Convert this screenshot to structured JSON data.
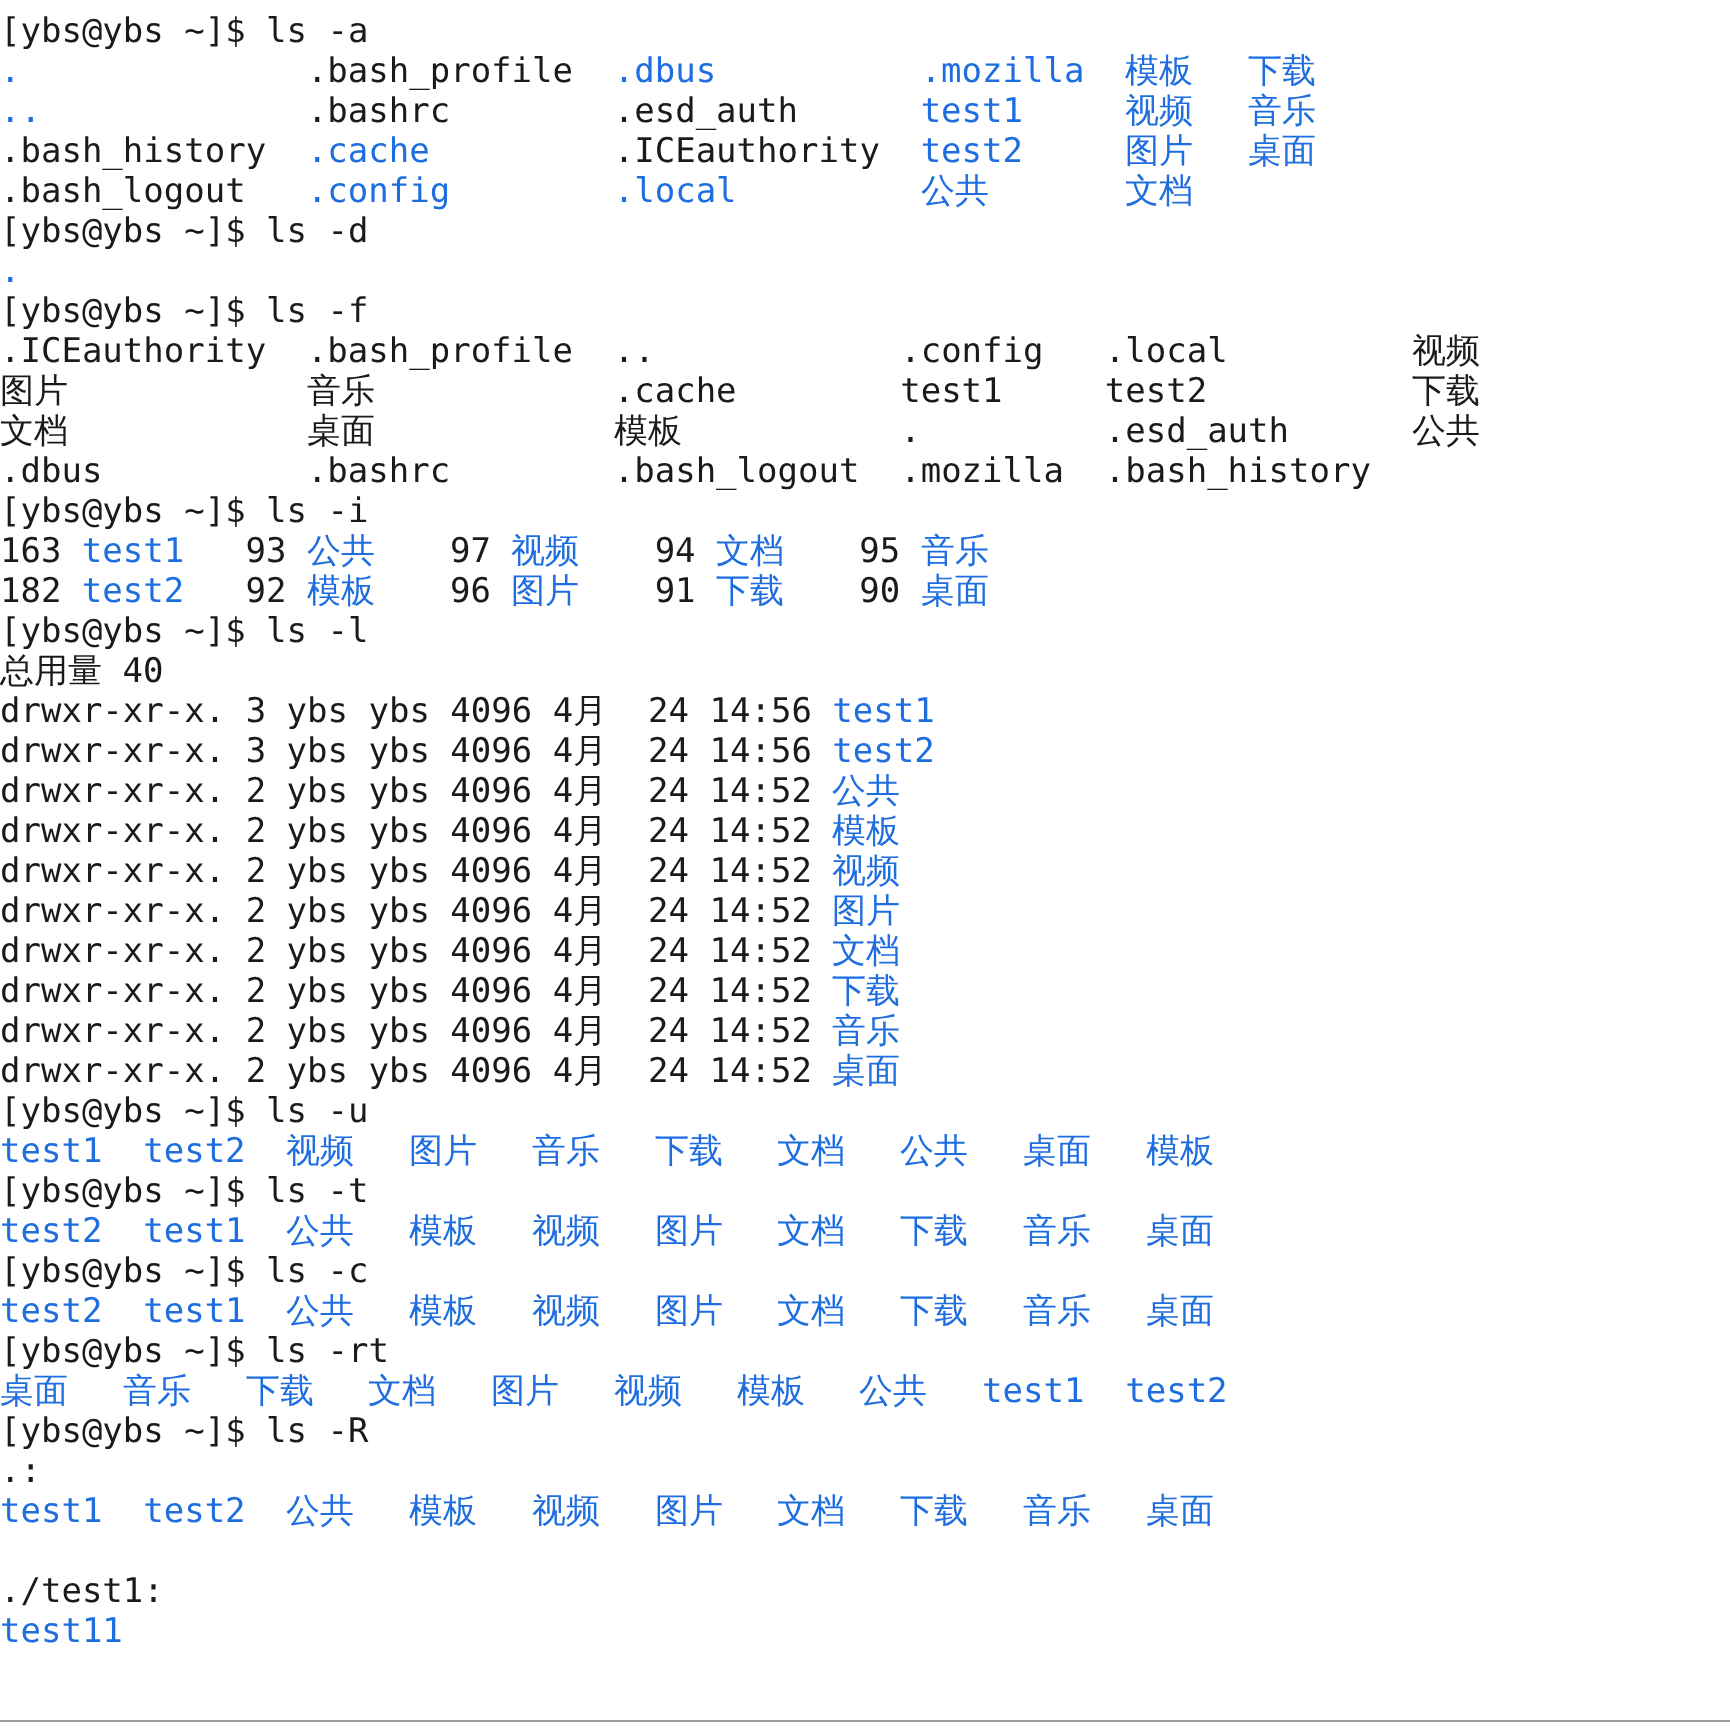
{
  "lines": [
    {
      "kind": "prompt",
      "text": "[ybs@ybs ~]$ ls -a"
    },
    {
      "kind": "grid",
      "rows": [
        [
          {
            "name": ".",
            "kind": "dir"
          },
          {
            "name": ".bash_profile",
            "kind": "file"
          },
          {
            "name": ".dbus",
            "kind": "dir"
          },
          {
            "name": ".mozilla",
            "kind": "dir"
          },
          {
            "name": "模板",
            "kind": "dir"
          },
          {
            "name": "下载",
            "kind": "dir"
          }
        ],
        [
          {
            "name": "..",
            "kind": "dir"
          },
          {
            "name": ".bashrc",
            "kind": "file"
          },
          {
            "name": ".esd_auth",
            "kind": "file"
          },
          {
            "name": "test1",
            "kind": "dir"
          },
          {
            "name": "视频",
            "kind": "dir"
          },
          {
            "name": "音乐",
            "kind": "dir"
          }
        ],
        [
          {
            "name": ".bash_history",
            "kind": "file"
          },
          {
            "name": ".cache",
            "kind": "dir"
          },
          {
            "name": ".ICEauthority",
            "kind": "file"
          },
          {
            "name": "test2",
            "kind": "dir"
          },
          {
            "name": "图片",
            "kind": "dir"
          },
          {
            "name": "桌面",
            "kind": "dir"
          }
        ],
        [
          {
            "name": ".bash_logout",
            "kind": "file"
          },
          {
            "name": ".config",
            "kind": "dir"
          },
          {
            "name": ".local",
            "kind": "dir"
          },
          {
            "name": "公共",
            "kind": "dir"
          },
          {
            "name": "文档",
            "kind": "dir"
          }
        ]
      ]
    },
    {
      "kind": "prompt",
      "text": "[ybs@ybs ~]$ ls -d"
    },
    {
      "kind": "grid",
      "rows": [
        [
          {
            "name": ".",
            "kind": "dir"
          }
        ]
      ]
    },
    {
      "kind": "prompt",
      "text": "[ybs@ybs ~]$ ls -f"
    },
    {
      "kind": "grid",
      "rows": [
        [
          {
            "name": ".ICEauthority",
            "kind": "file"
          },
          {
            "name": ".bash_profile",
            "kind": "file"
          },
          {
            "name": "..",
            "kind": "file"
          },
          {
            "name": ".config",
            "kind": "file"
          },
          {
            "name": ".local",
            "kind": "file"
          },
          {
            "name": "视频",
            "kind": "file"
          }
        ],
        [
          {
            "name": "图片",
            "kind": "file"
          },
          {
            "name": "音乐",
            "kind": "file"
          },
          {
            "name": ".cache",
            "kind": "file"
          },
          {
            "name": "test1",
            "kind": "file"
          },
          {
            "name": "test2",
            "kind": "file"
          },
          {
            "name": "下载",
            "kind": "file"
          }
        ],
        [
          {
            "name": "文档",
            "kind": "file"
          },
          {
            "name": "桌面",
            "kind": "file"
          },
          {
            "name": "模板",
            "kind": "file"
          },
          {
            "name": ".",
            "kind": "file"
          },
          {
            "name": ".esd_auth",
            "kind": "file"
          },
          {
            "name": "公共",
            "kind": "file"
          }
        ],
        [
          {
            "name": ".dbus",
            "kind": "file"
          },
          {
            "name": ".bashrc",
            "kind": "file"
          },
          {
            "name": ".bash_logout",
            "kind": "file"
          },
          {
            "name": ".mozilla",
            "kind": "file"
          },
          {
            "name": ".bash_history",
            "kind": "file"
          }
        ]
      ]
    },
    {
      "kind": "prompt",
      "text": "[ybs@ybs ~]$ ls -i"
    },
    {
      "kind": "grid",
      "rows": [
        [
          {
            "inode": "163",
            "name": "test1",
            "kind": "dir"
          },
          {
            "inode": "93",
            "name": "公共",
            "kind": "dir"
          },
          {
            "inode": "97",
            "name": "视频",
            "kind": "dir"
          },
          {
            "inode": "94",
            "name": "文档",
            "kind": "dir"
          },
          {
            "inode": "95",
            "name": "音乐",
            "kind": "dir"
          }
        ],
        [
          {
            "inode": "182",
            "name": "test2",
            "kind": "dir"
          },
          {
            "inode": "92",
            "name": "模板",
            "kind": "dir"
          },
          {
            "inode": "96",
            "name": "图片",
            "kind": "dir"
          },
          {
            "inode": "91",
            "name": "下载",
            "kind": "dir"
          },
          {
            "inode": "90",
            "name": "桌面",
            "kind": "dir"
          }
        ]
      ]
    },
    {
      "kind": "prompt",
      "text": "[ybs@ybs ~]$ ls -l"
    },
    {
      "kind": "text",
      "text": "总用量 40"
    },
    {
      "kind": "long",
      "info": "drwxr-xr-x. 3 ybs ybs 4096 4月  24 14:56",
      "file": {
        "name": "test1",
        "kind": "dir"
      }
    },
    {
      "kind": "long",
      "info": "drwxr-xr-x. 3 ybs ybs 4096 4月  24 14:56",
      "file": {
        "name": "test2",
        "kind": "dir"
      }
    },
    {
      "kind": "long",
      "info": "drwxr-xr-x. 2 ybs ybs 4096 4月  24 14:52",
      "file": {
        "name": "公共",
        "kind": "dir"
      }
    },
    {
      "kind": "long",
      "info": "drwxr-xr-x. 2 ybs ybs 4096 4月  24 14:52",
      "file": {
        "name": "模板",
        "kind": "dir"
      }
    },
    {
      "kind": "long",
      "info": "drwxr-xr-x. 2 ybs ybs 4096 4月  24 14:52",
      "file": {
        "name": "视频",
        "kind": "dir"
      }
    },
    {
      "kind": "long",
      "info": "drwxr-xr-x. 2 ybs ybs 4096 4月  24 14:52",
      "file": {
        "name": "图片",
        "kind": "dir"
      }
    },
    {
      "kind": "long",
      "info": "drwxr-xr-x. 2 ybs ybs 4096 4月  24 14:52",
      "file": {
        "name": "文档",
        "kind": "dir"
      }
    },
    {
      "kind": "long",
      "info": "drwxr-xr-x. 2 ybs ybs 4096 4月  24 14:52",
      "file": {
        "name": "下载",
        "kind": "dir"
      }
    },
    {
      "kind": "long",
      "info": "drwxr-xr-x. 2 ybs ybs 4096 4月  24 14:52",
      "file": {
        "name": "音乐",
        "kind": "dir"
      }
    },
    {
      "kind": "long",
      "info": "drwxr-xr-x. 2 ybs ybs 4096 4月  24 14:52",
      "file": {
        "name": "桌面",
        "kind": "dir"
      }
    },
    {
      "kind": "prompt",
      "text": "[ybs@ybs ~]$ ls -u"
    },
    {
      "kind": "grid",
      "rows": [
        [
          {
            "name": "test1",
            "kind": "dir"
          },
          {
            "name": "test2",
            "kind": "dir"
          },
          {
            "name": "视频",
            "kind": "dir"
          },
          {
            "name": "图片",
            "kind": "dir"
          },
          {
            "name": "音乐",
            "kind": "dir"
          },
          {
            "name": "下载",
            "kind": "dir"
          },
          {
            "name": "文档",
            "kind": "dir"
          },
          {
            "name": "公共",
            "kind": "dir"
          },
          {
            "name": "桌面",
            "kind": "dir"
          },
          {
            "name": "模板",
            "kind": "dir"
          }
        ]
      ]
    },
    {
      "kind": "prompt",
      "text": "[ybs@ybs ~]$ ls -t"
    },
    {
      "kind": "grid",
      "rows": [
        [
          {
            "name": "test2",
            "kind": "dir"
          },
          {
            "name": "test1",
            "kind": "dir"
          },
          {
            "name": "公共",
            "kind": "dir"
          },
          {
            "name": "模板",
            "kind": "dir"
          },
          {
            "name": "视频",
            "kind": "dir"
          },
          {
            "name": "图片",
            "kind": "dir"
          },
          {
            "name": "文档",
            "kind": "dir"
          },
          {
            "name": "下载",
            "kind": "dir"
          },
          {
            "name": "音乐",
            "kind": "dir"
          },
          {
            "name": "桌面",
            "kind": "dir"
          }
        ]
      ]
    },
    {
      "kind": "prompt",
      "text": "[ybs@ybs ~]$ ls -c"
    },
    {
      "kind": "grid",
      "rows": [
        [
          {
            "name": "test2",
            "kind": "dir"
          },
          {
            "name": "test1",
            "kind": "dir"
          },
          {
            "name": "公共",
            "kind": "dir"
          },
          {
            "name": "模板",
            "kind": "dir"
          },
          {
            "name": "视频",
            "kind": "dir"
          },
          {
            "name": "图片",
            "kind": "dir"
          },
          {
            "name": "文档",
            "kind": "dir"
          },
          {
            "name": "下载",
            "kind": "dir"
          },
          {
            "name": "音乐",
            "kind": "dir"
          },
          {
            "name": "桌面",
            "kind": "dir"
          }
        ]
      ]
    },
    {
      "kind": "prompt",
      "text": "[ybs@ybs ~]$ ls -rt"
    },
    {
      "kind": "grid",
      "rows": [
        [
          {
            "name": "桌面",
            "kind": "dir"
          },
          {
            "name": "音乐",
            "kind": "dir"
          },
          {
            "name": "下载",
            "kind": "dir"
          },
          {
            "name": "文档",
            "kind": "dir"
          },
          {
            "name": "图片",
            "kind": "dir"
          },
          {
            "name": "视频",
            "kind": "dir"
          },
          {
            "name": "模板",
            "kind": "dir"
          },
          {
            "name": "公共",
            "kind": "dir"
          },
          {
            "name": "test1",
            "kind": "dir"
          },
          {
            "name": "test2",
            "kind": "dir"
          }
        ]
      ]
    },
    {
      "kind": "prompt",
      "text": "[ybs@ybs ~]$ ls -R"
    },
    {
      "kind": "text",
      "text": ".:"
    },
    {
      "kind": "grid",
      "rows": [
        [
          {
            "name": "test1",
            "kind": "dir"
          },
          {
            "name": "test2",
            "kind": "dir"
          },
          {
            "name": "公共",
            "kind": "dir"
          },
          {
            "name": "模板",
            "kind": "dir"
          },
          {
            "name": "视频",
            "kind": "dir"
          },
          {
            "name": "图片",
            "kind": "dir"
          },
          {
            "name": "文档",
            "kind": "dir"
          },
          {
            "name": "下载",
            "kind": "dir"
          },
          {
            "name": "音乐",
            "kind": "dir"
          },
          {
            "name": "桌面",
            "kind": "dir"
          }
        ]
      ]
    },
    {
      "kind": "blank"
    },
    {
      "kind": "text",
      "text": "./test1:"
    },
    {
      "kind": "grid",
      "rows": [
        [
          {
            "name": "test11",
            "kind": "dir"
          }
        ]
      ]
    }
  ]
}
